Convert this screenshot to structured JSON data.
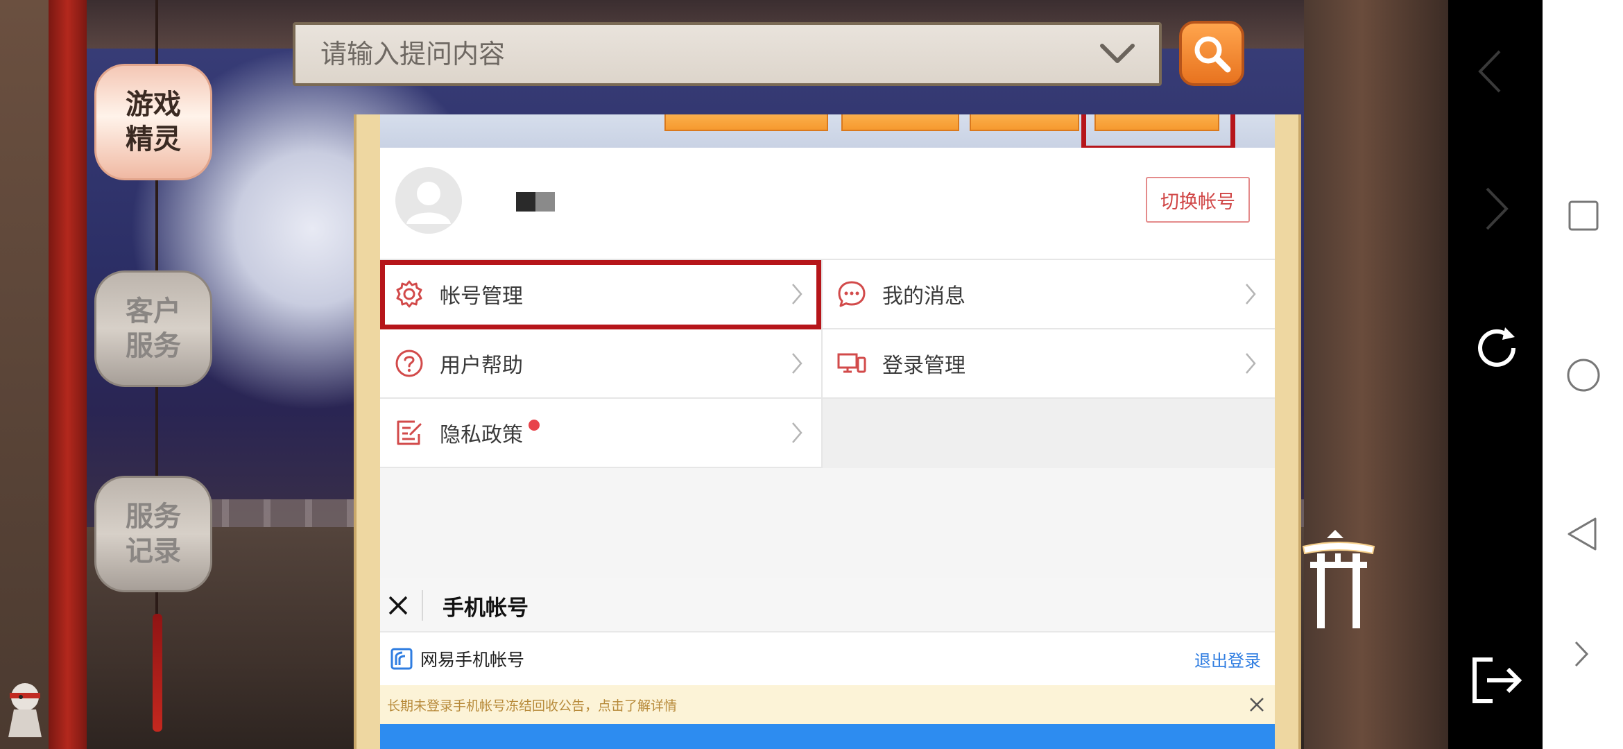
{
  "sidebar": {
    "items": [
      {
        "label": "游戏精灵",
        "active": true
      },
      {
        "label": "客户服务",
        "active": false
      },
      {
        "label": "服务记录",
        "active": false
      }
    ]
  },
  "search": {
    "placeholder": "请输入提问内容"
  },
  "panel": {
    "switch_account_label": "切换帐号",
    "menu": [
      {
        "label": "帐号管理",
        "icon": "gear-icon"
      },
      {
        "label": "我的消息",
        "icon": "chat-icon"
      },
      {
        "label": "用户帮助",
        "icon": "help-icon"
      },
      {
        "label": "登录管理",
        "icon": "devices-icon"
      },
      {
        "label": "隐私政策",
        "icon": "policy-icon"
      }
    ],
    "bottom_title": "手机帐号",
    "account_title": "网易手机帐号",
    "logout_label": "退出登录",
    "notice": "长期未登录手机帐号冻结回收公告，点击了解详情"
  },
  "colors": {
    "accent_red": "#b6151a",
    "tab_orange": "#f69a2f",
    "link_blue": "#2f7de1",
    "notice_bg": "#fcf3d7"
  }
}
